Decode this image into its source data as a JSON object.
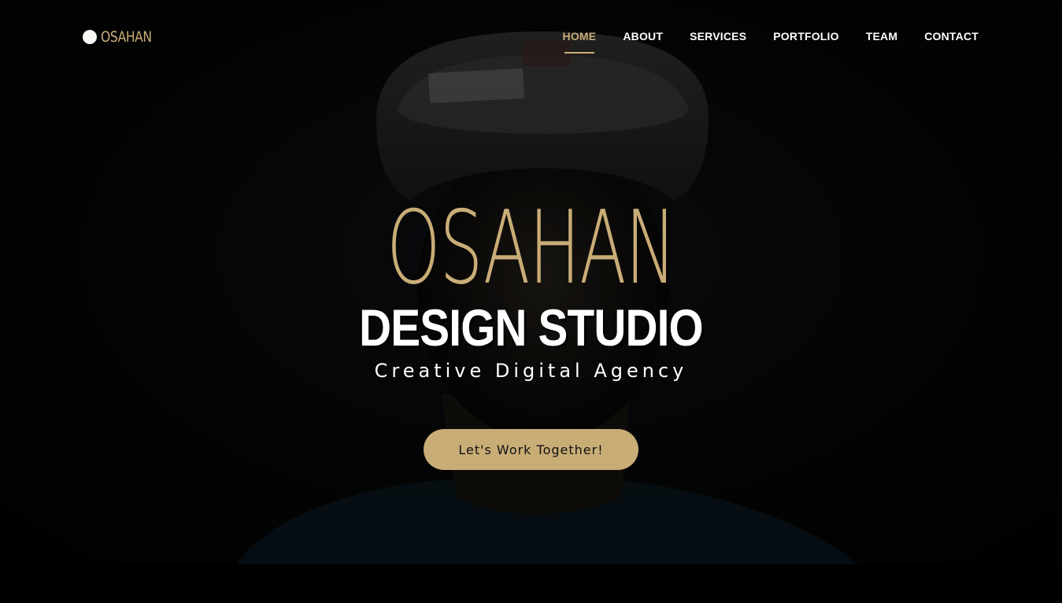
{
  "header": {
    "logo_text": "OSAHAN",
    "nav": [
      {
        "label": "HOME",
        "active": true
      },
      {
        "label": "ABOUT",
        "active": false
      },
      {
        "label": "SERVICES",
        "active": false
      },
      {
        "label": "PORTFOLIO",
        "active": false
      },
      {
        "label": "TEAM",
        "active": false
      },
      {
        "label": "CONTACT",
        "active": false
      }
    ]
  },
  "hero": {
    "title": "OSAHAN",
    "subtitle": "DESIGN STUDIO",
    "tagline": "Creative Digital Agency",
    "cta_label": "Let's Work Together!",
    "background_image": "portrait of man in cap on dark background"
  },
  "colors": {
    "accent": "#c9ad77",
    "background": "#000000",
    "text": "#ffffff"
  }
}
